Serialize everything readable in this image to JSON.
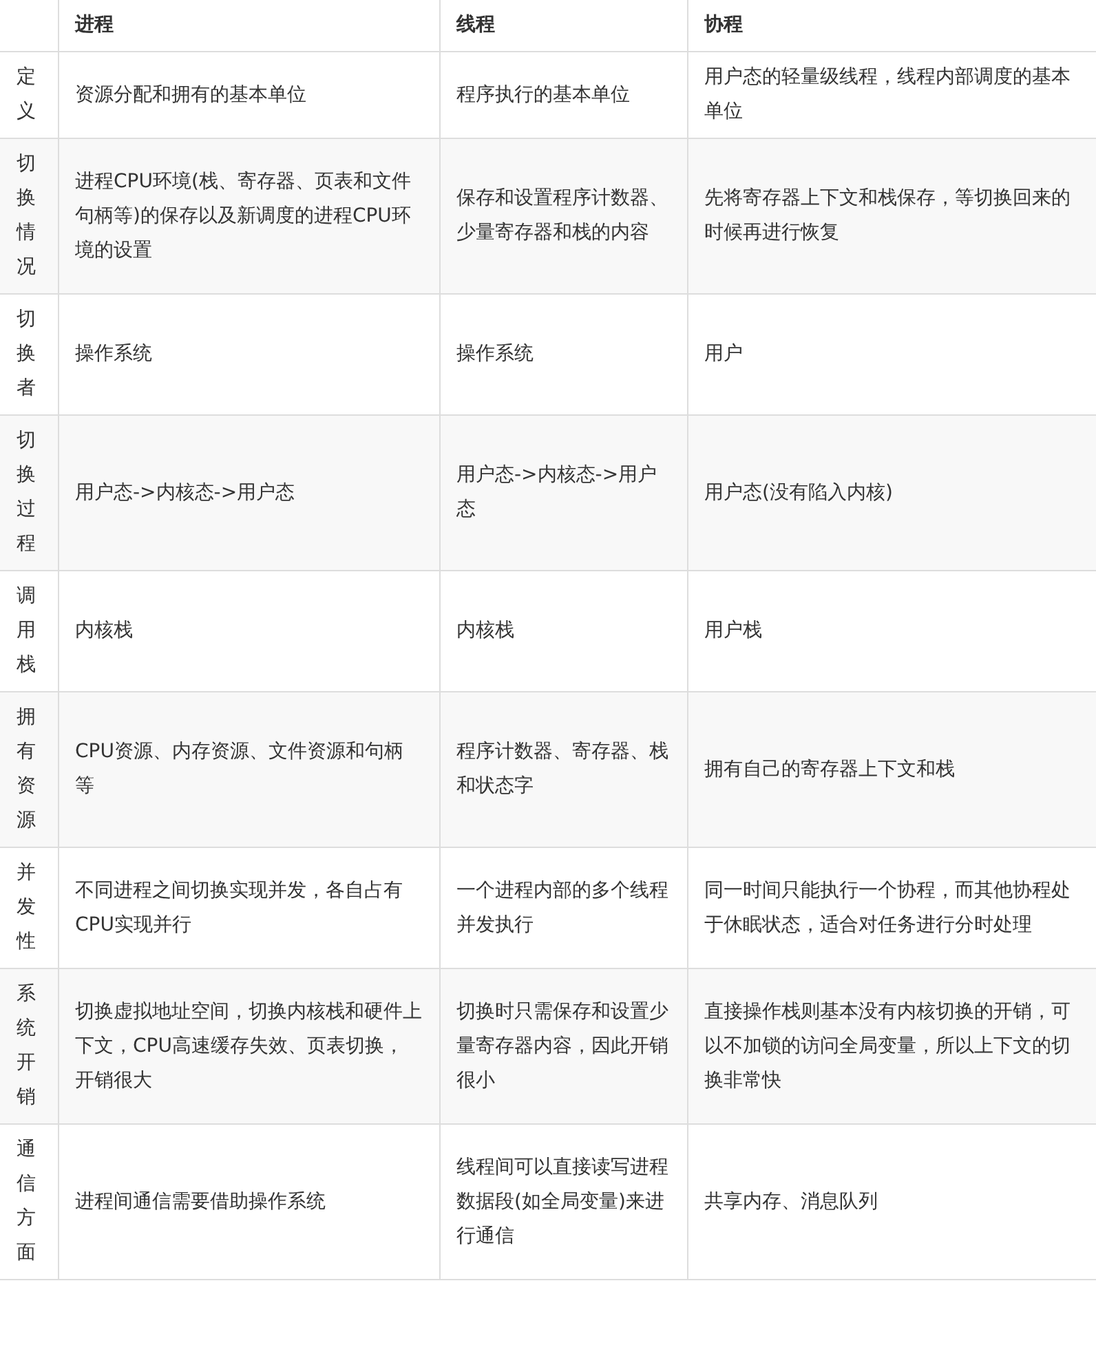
{
  "table": {
    "columns": [
      "进程",
      "线程",
      "协程"
    ],
    "rows": [
      {
        "label": "定义",
        "cells": [
          "资源分配和拥有的基本单位",
          "程序执行的基本单位",
          "用户态的轻量级线程，线程内部调度的基本单位"
        ]
      },
      {
        "label": "切换情况",
        "cells": [
          "进程CPU环境(栈、寄存器、页表和文件句柄等)的保存以及新调度的进程CPU环境的设置",
          "保存和设置程序计数器、少量寄存器和栈的内容",
          "先将寄存器上下文和栈保存，等切换回来的时候再进行恢复"
        ]
      },
      {
        "label": "切换者",
        "cells": [
          "操作系统",
          "操作系统",
          "用户"
        ]
      },
      {
        "label": "切换过程",
        "cells": [
          "用户态->内核态->用户态",
          "用户态->内核态->用户态",
          "用户态(没有陷入内核)"
        ]
      },
      {
        "label": "调用栈",
        "cells": [
          "内核栈",
          "内核栈",
          "用户栈"
        ]
      },
      {
        "label": "拥有资源",
        "cells": [
          "CPU资源、内存资源、文件资源和句柄等",
          "程序计数器、寄存器、栈和状态字",
          "拥有自己的寄存器上下文和栈"
        ]
      },
      {
        "label": "并发性",
        "cells": [
          "不同进程之间切换实现并发，各自占有CPU实现并行",
          "一个进程内部的多个线程并发执行",
          "同一时间只能执行一个协程，而其他协程处于休眠状态，适合对任务进行分时处理"
        ]
      },
      {
        "label": "系统开销",
        "cells": [
          "切换虚拟地址空间，切换内核栈和硬件上下文，CPU高速缓存失效、页表切换，开销很大",
          "切换时只需保存和设置少量寄存器内容，因此开销很小",
          "直接操作栈则基本没有内核切换的开销，可以不加锁的访问全局变量，所以上下文的切换非常快"
        ]
      },
      {
        "label": "通信方面",
        "cells": [
          "进程间通信需要借助操作系统",
          "线程间可以直接读写进程数据段(如全局变量)来进行通信",
          "共享内存、消息队列"
        ]
      }
    ]
  }
}
